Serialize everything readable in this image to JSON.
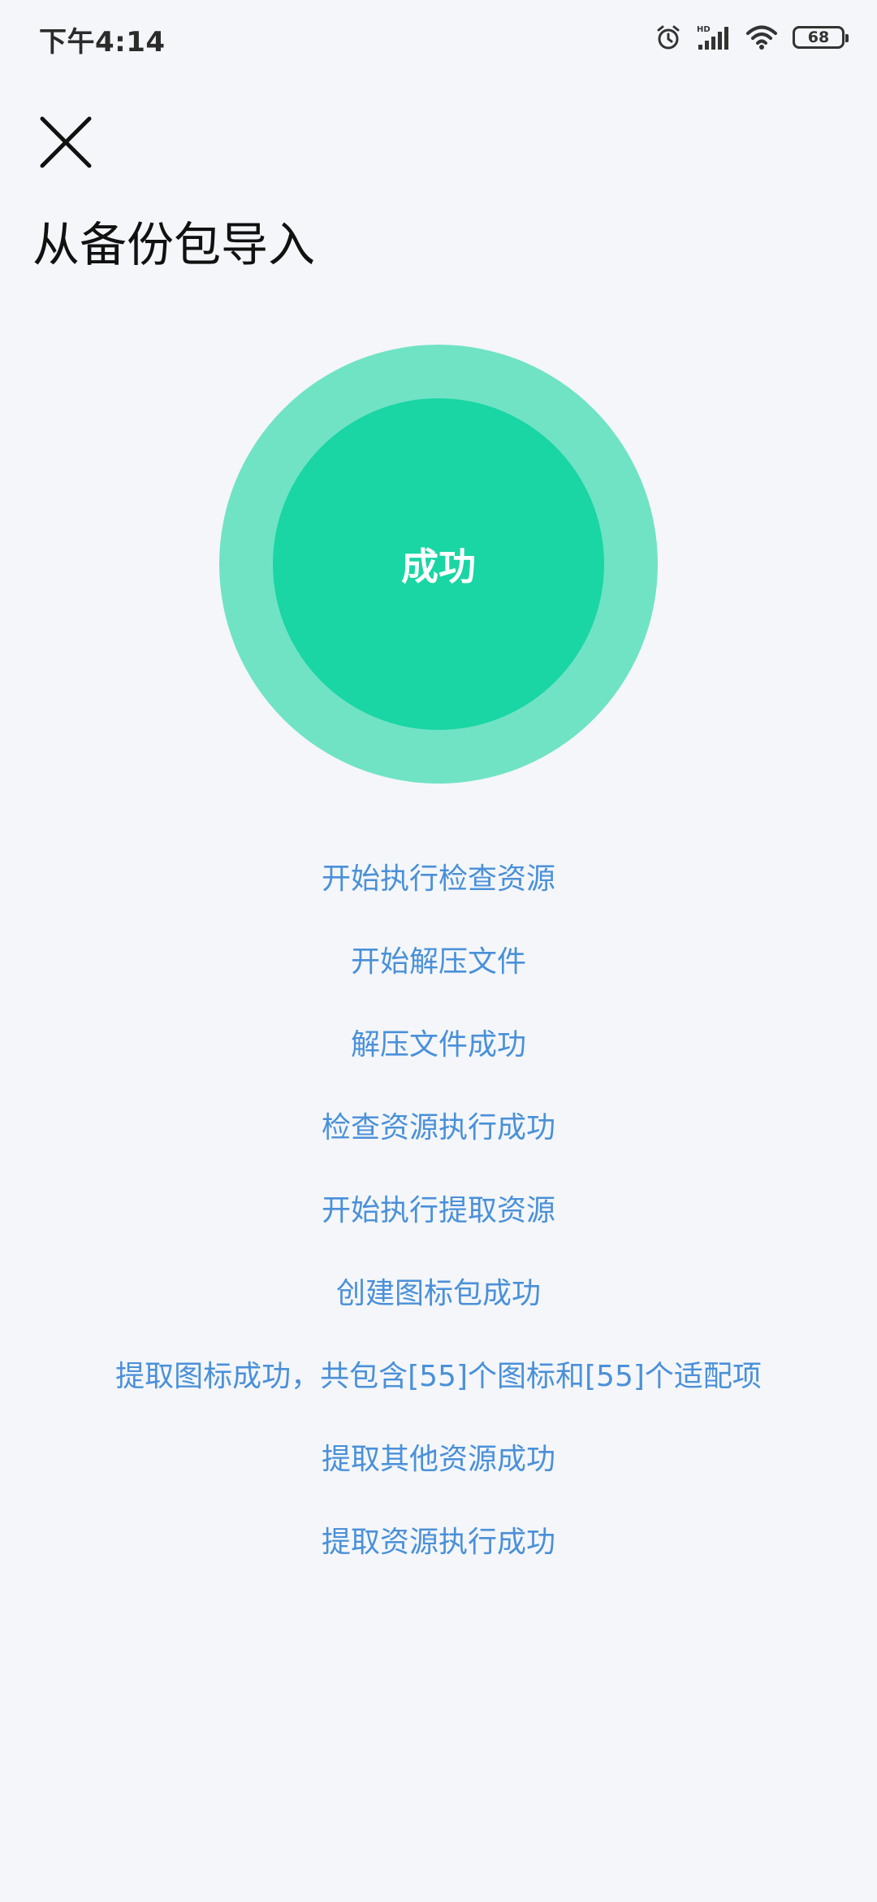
{
  "status_bar": {
    "time": "下午4:14",
    "battery_level": "68",
    "icons": [
      "alarm-icon",
      "hd-signal-icon",
      "wifi-icon",
      "battery-icon"
    ]
  },
  "header": {
    "close_icon": "close-icon",
    "title": "从备份包导入"
  },
  "result": {
    "label": "成功",
    "outer_color": "#70e3c5",
    "inner_color": "#19d6a4"
  },
  "log": {
    "color": "#4a90d9",
    "items": [
      "开始执行检查资源",
      "开始解压文件",
      "解压文件成功",
      "检查资源执行成功",
      "开始执行提取资源",
      "创建图标包成功",
      "提取图标成功，共包含[55]个图标和[55]个适配项",
      "提取其他资源成功",
      "提取资源执行成功"
    ]
  }
}
